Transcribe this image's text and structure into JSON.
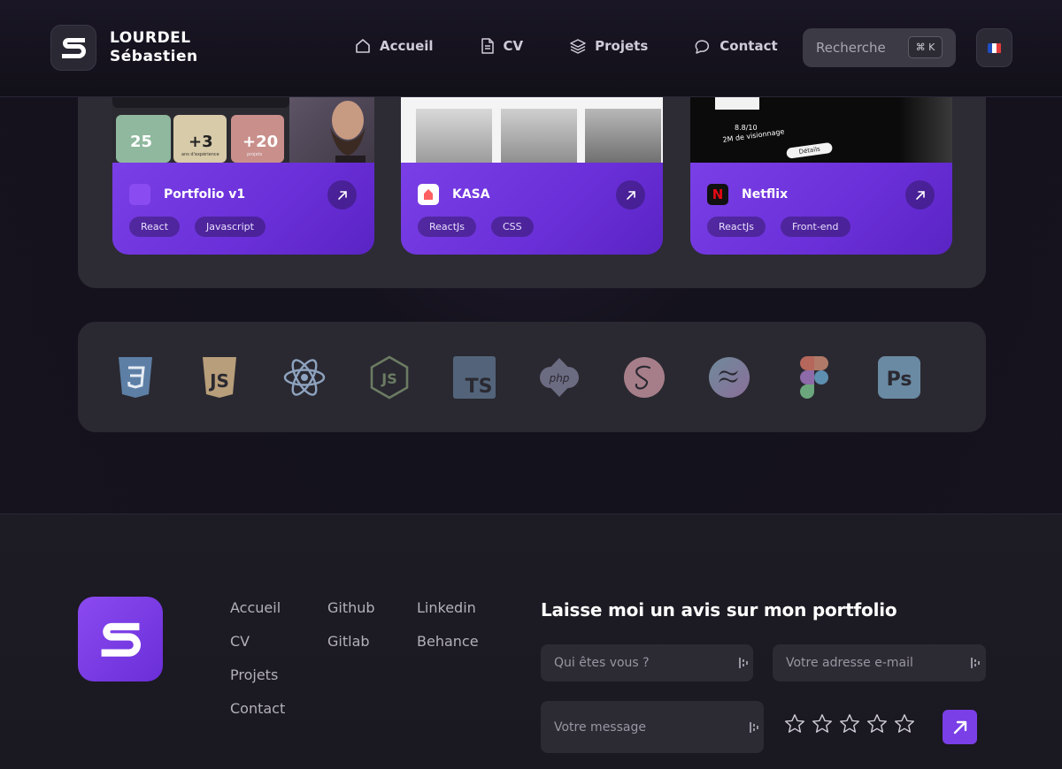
{
  "brand": {
    "line1": "LOURDEL",
    "line2": "Sébastien"
  },
  "nav": [
    {
      "label": "Accueil",
      "icon": "home-icon"
    },
    {
      "label": "CV",
      "icon": "document-icon"
    },
    {
      "label": "Projets",
      "icon": "layers-icon"
    },
    {
      "label": "Contact",
      "icon": "chat-icon"
    }
  ],
  "search": {
    "label": "Recherche",
    "shortcut": "⌘ K"
  },
  "language": {
    "icon": "french-flag-icon",
    "colors": [
      "#1f4fbf",
      "#ffffff",
      "#e23b3b"
    ]
  },
  "projects": [
    {
      "title": "Portfolio v1",
      "tags": [
        "React",
        "Javascript"
      ],
      "stats": [
        "25",
        "+3",
        "+20"
      ],
      "stat_captions": [
        "",
        "ans d'expérience",
        "projets"
      ]
    },
    {
      "title": "KASA",
      "tags": [
        "ReactJs",
        "CSS"
      ]
    },
    {
      "title": "Netflix",
      "tags": [
        "ReactJs",
        "Front-end"
      ],
      "rating": "8.8/10",
      "views": "2M de visionnage",
      "details": "Détails"
    }
  ],
  "tech": [
    "css3-icon",
    "javascript-icon",
    "react-icon",
    "nodejs-icon",
    "typescript-icon",
    "php-icon",
    "sass-icon",
    "tailwind-icon",
    "figma-icon",
    "photoshop-icon"
  ],
  "footer": {
    "col1": [
      "Accueil",
      "CV",
      "Projets",
      "Contact"
    ],
    "col2": [
      "Github",
      "Gitlab"
    ],
    "col3": [
      "Linkedin",
      "Behance"
    ],
    "review_title": "Laisse moi un avis sur mon portfolio",
    "name_placeholder": "Qui êtes vous ?",
    "email_placeholder": "Votre adresse e-mail",
    "message_placeholder": "Votre message",
    "rating_value": 0,
    "rating_max": 5
  },
  "colors": {
    "accent": "#7a3fe6",
    "panel": "#2d2c35",
    "bg": "#14121c"
  }
}
